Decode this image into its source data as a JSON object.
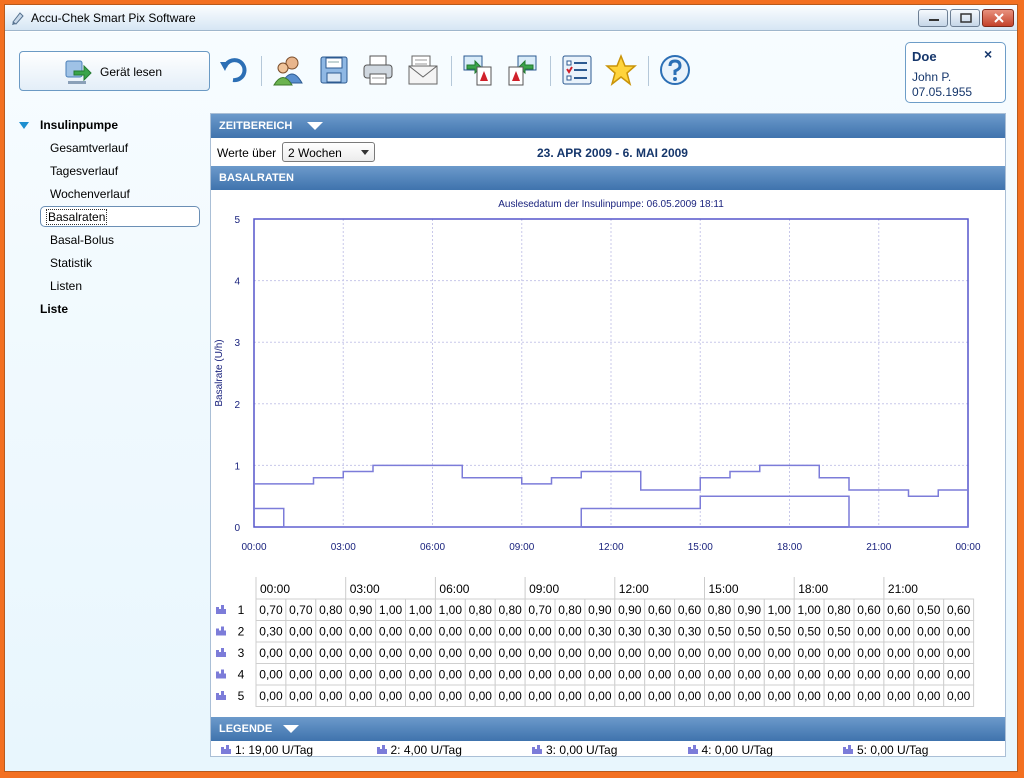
{
  "window": {
    "title": "Accu-Chek Smart Pix Software"
  },
  "toolbar": {
    "read_device_label": "Gerät lesen",
    "icons": [
      "undo-icon",
      "patients-icon",
      "save-icon",
      "print-icon",
      "email-icon",
      "export-pdf-icon",
      "import-pdf-icon",
      "settings-list-icon",
      "favorites-star-icon",
      "help-icon"
    ]
  },
  "patient": {
    "last_name": "Doe",
    "first_name": "John P.",
    "birth_date": "07.05.1955",
    "close_symbol": "×"
  },
  "nav": {
    "section1": "Insulinpumpe",
    "items": [
      "Gesamtverlauf",
      "Tagesverlauf",
      "Wochenverlauf",
      "Basalraten",
      "Basal-Bolus",
      "Statistik",
      "Listen"
    ],
    "selected": "Basalraten",
    "section2": "Liste"
  },
  "zeitbereich": {
    "header": "ZEITBEREICH",
    "label": "Werte über",
    "selected": "2 Wochen",
    "range": "23. APR 2009 - 6. MAI 2009"
  },
  "basalraten_header": "BASALRATEN",
  "legend_header": "LEGENDE",
  "colors": {
    "header": "#4a7fb8",
    "series": "#7c7cd9",
    "axis": "#1a237e",
    "grid": "#c8c8ea"
  },
  "chart_data": {
    "type": "line",
    "title": "Auslesedatum der Insulinpumpe: 06.05.2009 18:11",
    "ylabel": "Basalrate (U/h)",
    "xlabel": "",
    "x_ticks": [
      "00:00",
      "03:00",
      "06:00",
      "09:00",
      "12:00",
      "15:00",
      "18:00",
      "21:00",
      "00:00"
    ],
    "y_ticks": [
      "0",
      "1",
      "2",
      "3",
      "4",
      "5"
    ],
    "ylim": [
      0,
      5
    ],
    "xlim": [
      0,
      24
    ],
    "grid": true,
    "step": true,
    "series": [
      {
        "name": "1",
        "values": [
          0.7,
          0.7,
          0.8,
          0.9,
          1.0,
          1.0,
          1.0,
          0.8,
          0.8,
          0.7,
          0.8,
          0.9,
          0.9,
          0.6,
          0.6,
          0.8,
          0.9,
          1.0,
          1.0,
          0.8,
          0.6,
          0.6,
          0.5,
          0.6
        ]
      },
      {
        "name": "2",
        "values": [
          0.3,
          0.0,
          0.0,
          0.0,
          0.0,
          0.0,
          0.0,
          0.0,
          0.0,
          0.0,
          0.0,
          0.3,
          0.3,
          0.3,
          0.3,
          0.5,
          0.5,
          0.5,
          0.5,
          0.5,
          0.0,
          0.0,
          0.0,
          0.0
        ]
      }
    ]
  },
  "table": {
    "time_headers": [
      "00:00",
      "03:00",
      "06:00",
      "09:00",
      "12:00",
      "15:00",
      "18:00",
      "21:00"
    ],
    "rows": [
      {
        "id": "1",
        "cells": [
          "0,70",
          "0,70",
          "0,80",
          "0,90",
          "1,00",
          "1,00",
          "1,00",
          "0,80",
          "0,80",
          "0,70",
          "0,80",
          "0,90",
          "0,90",
          "0,60",
          "0,60",
          "0,80",
          "0,90",
          "1,00",
          "1,00",
          "0,80",
          "0,60",
          "0,60",
          "0,50",
          "0,60"
        ]
      },
      {
        "id": "2",
        "cells": [
          "0,30",
          "0,00",
          "0,00",
          "0,00",
          "0,00",
          "0,00",
          "0,00",
          "0,00",
          "0,00",
          "0,00",
          "0,00",
          "0,30",
          "0,30",
          "0,30",
          "0,30",
          "0,50",
          "0,50",
          "0,50",
          "0,50",
          "0,50",
          "0,00",
          "0,00",
          "0,00",
          "0,00"
        ]
      },
      {
        "id": "3",
        "cells": [
          "0,00",
          "0,00",
          "0,00",
          "0,00",
          "0,00",
          "0,00",
          "0,00",
          "0,00",
          "0,00",
          "0,00",
          "0,00",
          "0,00",
          "0,00",
          "0,00",
          "0,00",
          "0,00",
          "0,00",
          "0,00",
          "0,00",
          "0,00",
          "0,00",
          "0,00",
          "0,00",
          "0,00"
        ]
      },
      {
        "id": "4",
        "cells": [
          "0,00",
          "0,00",
          "0,00",
          "0,00",
          "0,00",
          "0,00",
          "0,00",
          "0,00",
          "0,00",
          "0,00",
          "0,00",
          "0,00",
          "0,00",
          "0,00",
          "0,00",
          "0,00",
          "0,00",
          "0,00",
          "0,00",
          "0,00",
          "0,00",
          "0,00",
          "0,00",
          "0,00"
        ]
      },
      {
        "id": "5",
        "cells": [
          "0,00",
          "0,00",
          "0,00",
          "0,00",
          "0,00",
          "0,00",
          "0,00",
          "0,00",
          "0,00",
          "0,00",
          "0,00",
          "0,00",
          "0,00",
          "0,00",
          "0,00",
          "0,00",
          "0,00",
          "0,00",
          "0,00",
          "0,00",
          "0,00",
          "0,00",
          "0,00",
          "0,00"
        ]
      }
    ]
  },
  "legend": [
    "1: 19,00 U/Tag",
    "2: 4,00 U/Tag",
    "3: 0,00 U/Tag",
    "4: 0,00 U/Tag",
    "5: 0,00 U/Tag"
  ]
}
